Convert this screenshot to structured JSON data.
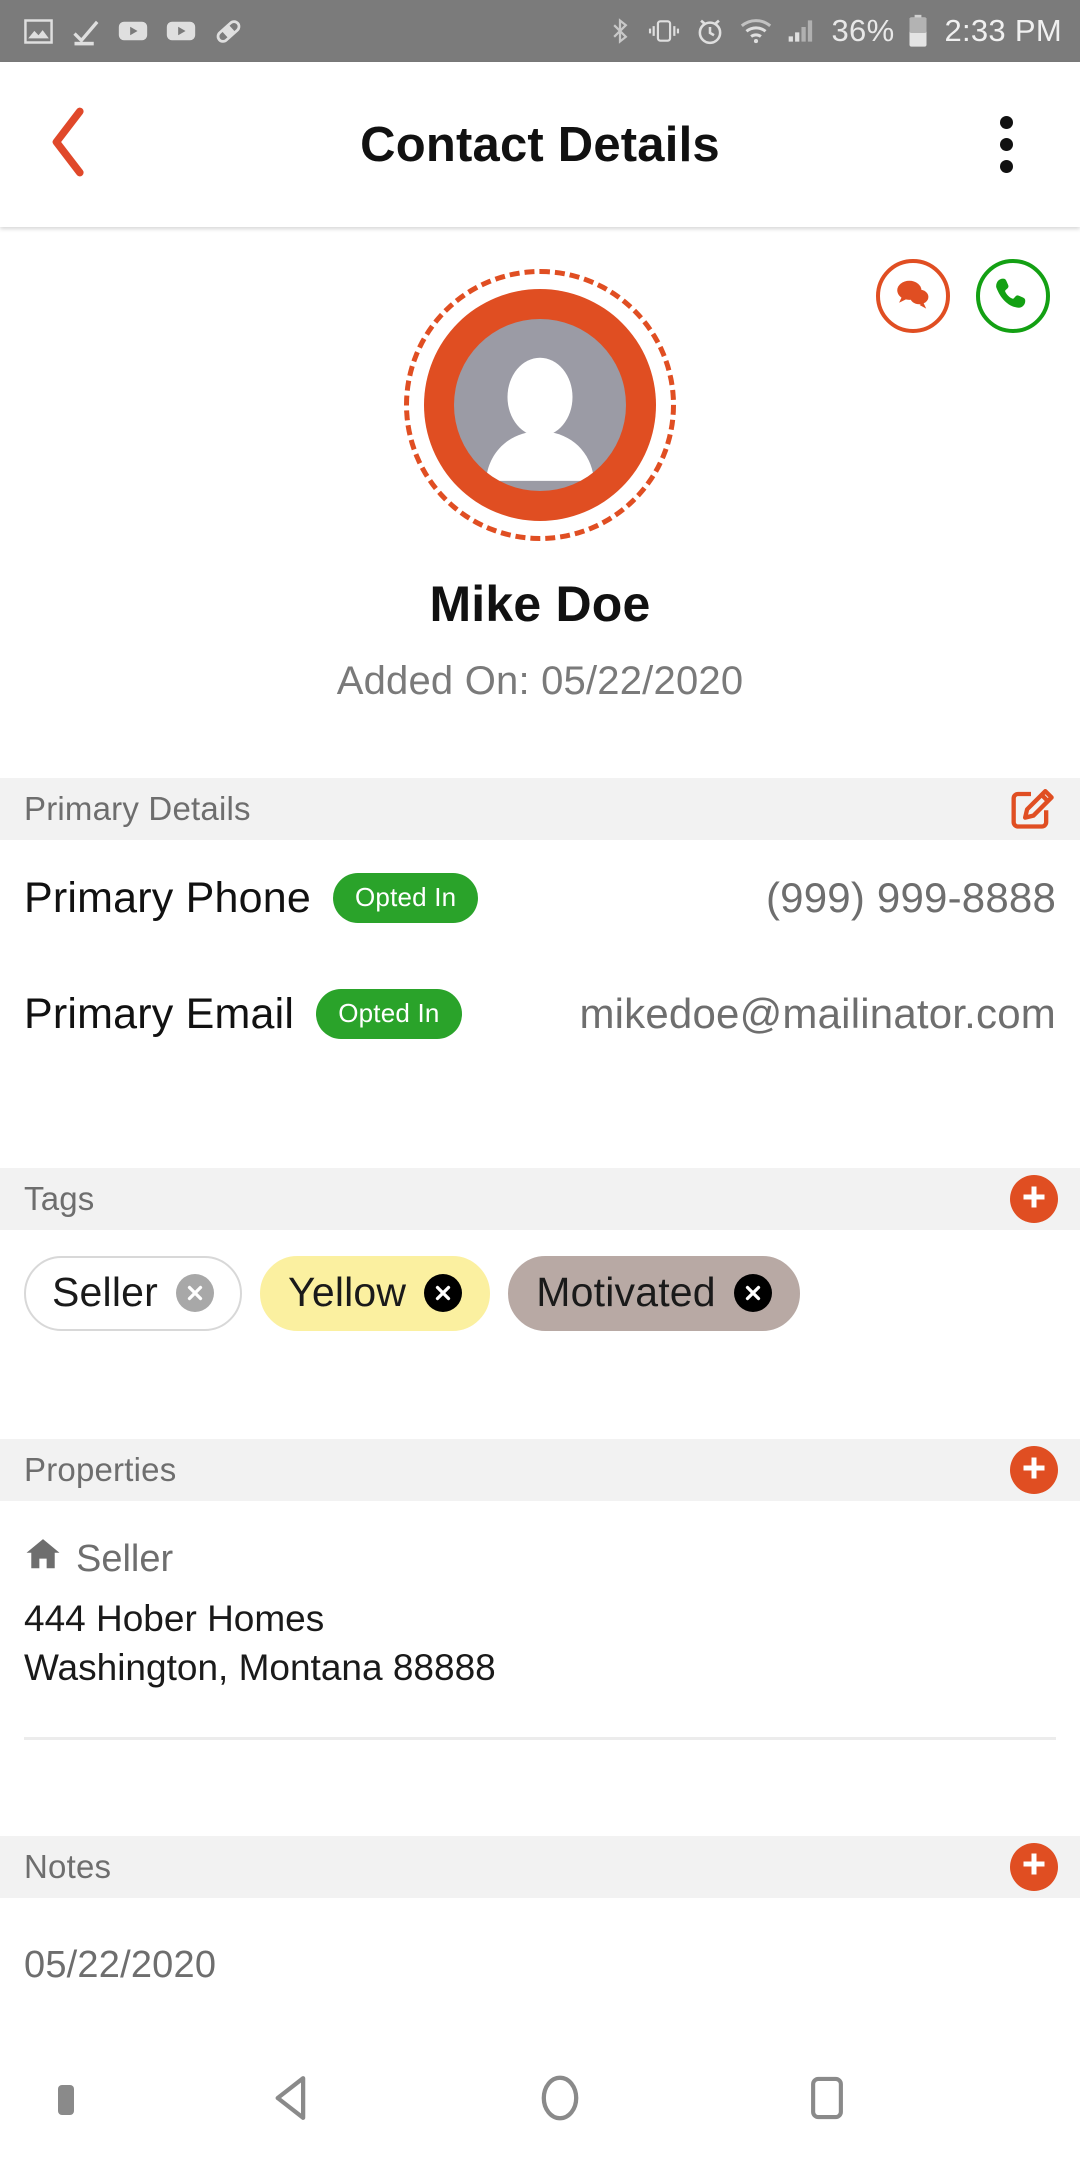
{
  "statusbar": {
    "left_icons": [
      "image-icon",
      "download-check-icon",
      "youtube-icon",
      "youtube-icon",
      "bandage-icon"
    ],
    "right_icons": [
      "bluetooth-icon",
      "vibrate-icon",
      "alarm-icon",
      "wifi-icon",
      "cellular-signal-icon"
    ],
    "battery_percent": "36%",
    "time": "2:33 PM"
  },
  "appbar": {
    "title": "Contact Details",
    "back_icon": "chevron-left-icon",
    "overflow_icon": "more-vertical-icon"
  },
  "profile": {
    "name": "Mike Doe",
    "added_on": "Added On: 05/22/2020",
    "avatar_icon": "person-avatar-icon",
    "sms_icon": "chat-bubble-icon",
    "call_icon": "phone-icon"
  },
  "primary_details": {
    "title": "Primary Details",
    "edit_icon": "edit-pencil-icon",
    "rows": [
      {
        "label": "Primary Phone",
        "badge": "Opted In",
        "value": "(999) 999-8888"
      },
      {
        "label": "Primary Email",
        "badge": "Opted In",
        "value": "mikedoe@mailinator.com"
      }
    ]
  },
  "tags": {
    "title": "Tags",
    "add_icon": "plus-circle-icon",
    "items": [
      {
        "label": "Seller",
        "bg": "#ffffff",
        "border": "#d8d8d8",
        "text": "#1a1a1a",
        "x_bg": "#a8a8a8",
        "x_fg": "#ffffff"
      },
      {
        "label": "Yellow",
        "bg": "#fbf0a0",
        "border": "#fbf0a0",
        "text": "#1a1a1a",
        "x_bg": "#000000",
        "x_fg": "#ffffff"
      },
      {
        "label": "Motivated",
        "bg": "#b8a9a4",
        "border": "#b8a9a4",
        "text": "#1a1a1a",
        "x_bg": "#000000",
        "x_fg": "#ffffff"
      }
    ]
  },
  "properties": {
    "title": "Properties",
    "add_icon": "plus-circle-icon",
    "items": [
      {
        "type_icon": "home-icon",
        "type": "Seller",
        "address_line1": "444 Hober Homes",
        "address_line2": "Washington, Montana 88888"
      }
    ]
  },
  "notes": {
    "title": "Notes",
    "add_icon": "plus-circle-icon",
    "items": [
      {
        "date": "05/22/2020"
      }
    ]
  },
  "navbar": {
    "back_icon": "nav-back-triangle-icon",
    "home_icon": "nav-home-circle-icon",
    "recents_icon": "nav-recents-square-icon"
  },
  "colors": {
    "accent": "#e04e22",
    "green": "#2aa32a",
    "section_bg": "#f2f2f2"
  }
}
